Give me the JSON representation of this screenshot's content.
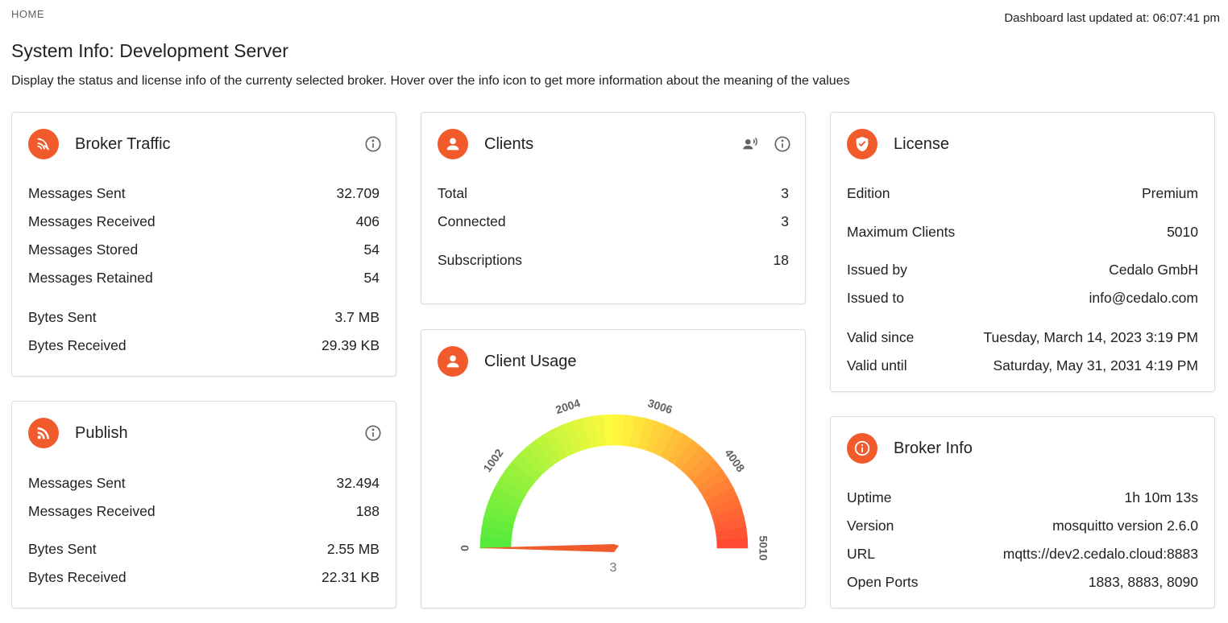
{
  "breadcrumb": "HOME",
  "last_updated": "Dashboard last updated at: 06:07:41 pm",
  "title": "System Info: Development Server",
  "description": "Display the status and license info of the currenty selected broker. Hover over the info icon to get more information about the meaning of the values",
  "colors": {
    "accent": "#f15a2b"
  },
  "broker_traffic": {
    "title": "Broker Traffic",
    "icon": "broker-traffic-icon",
    "rows": [
      {
        "label": "Messages Sent",
        "value": "32.709"
      },
      {
        "label": "Messages Received",
        "value": "406"
      },
      {
        "label": "Messages Stored",
        "value": "54"
      },
      {
        "label": "Messages Retained",
        "value": "54"
      },
      {
        "label": "Bytes Sent",
        "value": "3.7 MB"
      },
      {
        "label": "Bytes Received",
        "value": "29.39 KB"
      }
    ]
  },
  "publish": {
    "title": "Publish",
    "icon": "rss-icon",
    "rows": [
      {
        "label": "Messages Sent",
        "value": "32.494"
      },
      {
        "label": "Messages Received",
        "value": "188"
      },
      {
        "label": "Bytes Sent",
        "value": "2.55 MB"
      },
      {
        "label": "Bytes Received",
        "value": "22.31 KB"
      }
    ]
  },
  "clients": {
    "title": "Clients",
    "icon": "person-icon",
    "rows": [
      {
        "label": "Total",
        "value": "3"
      },
      {
        "label": "Connected",
        "value": "3"
      },
      {
        "label": "Subscriptions",
        "value": "18"
      }
    ]
  },
  "client_usage": {
    "title": "Client Usage",
    "icon": "person-icon",
    "min": 0,
    "max": 5010,
    "value": 3,
    "value_label": "3",
    "ticks": [
      "0",
      "1002",
      "2004",
      "3006",
      "4008",
      "5010"
    ]
  },
  "license": {
    "title": "License",
    "icon": "shield-check-icon",
    "rows": [
      {
        "label": "Edition",
        "value": "Premium"
      },
      {
        "label": "Maximum Clients",
        "value": "5010"
      },
      {
        "label": "Issued by",
        "value": "Cedalo GmbH"
      },
      {
        "label": "Issued to",
        "value": "info@cedalo.com"
      },
      {
        "label": "Valid since",
        "value": "Tuesday, March 14, 2023 3:19 PM"
      },
      {
        "label": "Valid until",
        "value": "Saturday, May 31, 2031 4:19 PM"
      }
    ]
  },
  "broker_info": {
    "title": "Broker Info",
    "icon": "info-icon",
    "rows": [
      {
        "label": "Uptime",
        "value": "1h 10m 13s"
      },
      {
        "label": "Version",
        "value": "mosquitto version 2.6.0"
      },
      {
        "label": "URL",
        "value": "mqtts://dev2.cedalo.cloud:8883"
      },
      {
        "label": "Open Ports",
        "value": "1883, 8883, 8090"
      }
    ]
  }
}
